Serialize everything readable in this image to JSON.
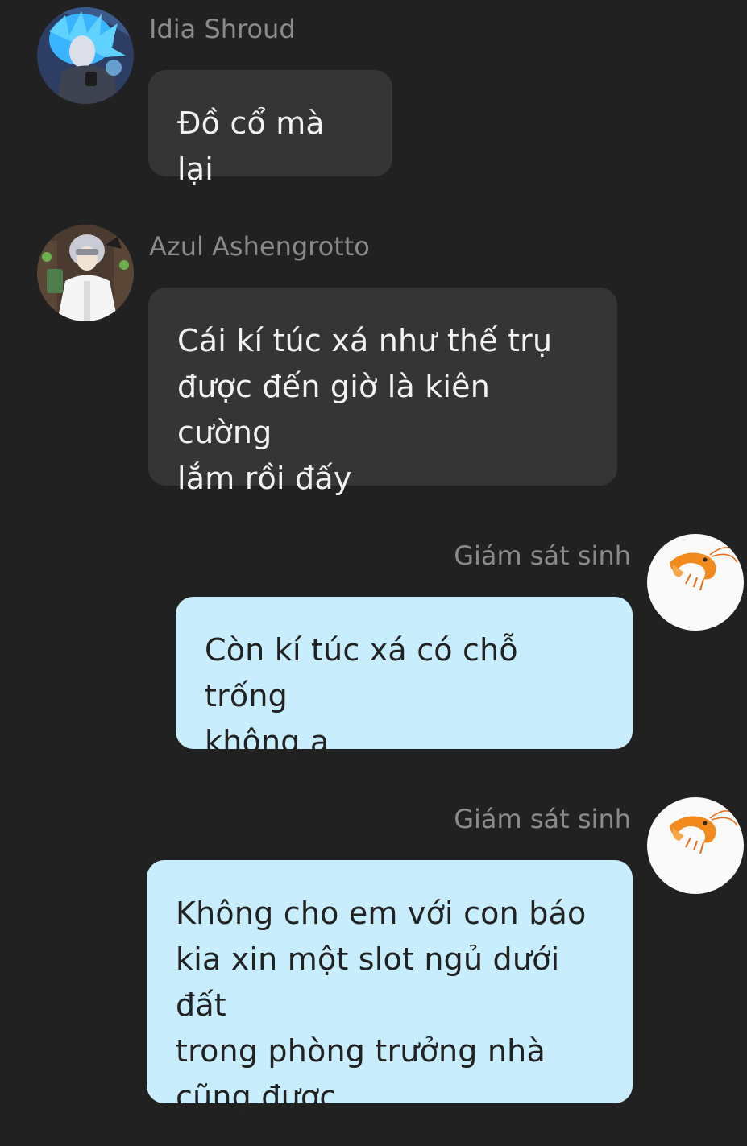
{
  "colors": {
    "background": "#212121",
    "incoming_bubble": "#353535",
    "outgoing_bubble": "#c8eefe",
    "sender_name": "#8a8a8a"
  },
  "messages": [
    {
      "direction": "incoming",
      "sender": "Idia Shroud",
      "avatar_icon": "blue-haired-character-avatar",
      "text": "Đồ cổ mà lại"
    },
    {
      "direction": "incoming",
      "sender": "Azul Ashengrotto",
      "avatar_icon": "white-coat-character-avatar",
      "text": "Cái kí túc xá như thế trụ\nđược đến giờ là kiên cường\nlắm rồi đấy"
    },
    {
      "direction": "outgoing",
      "sender": "Giám sát sinh",
      "avatar_icon": "shrimp-avatar",
      "text": "Còn kí túc xá có chỗ trống\nkhông ạ"
    },
    {
      "direction": "outgoing",
      "sender": "Giám sát sinh",
      "avatar_icon": "shrimp-avatar",
      "text": "Không cho em với con báo\nkia xin một slot ngủ dưới đất\ntrong phòng trưởng nhà\ncũng được"
    }
  ]
}
